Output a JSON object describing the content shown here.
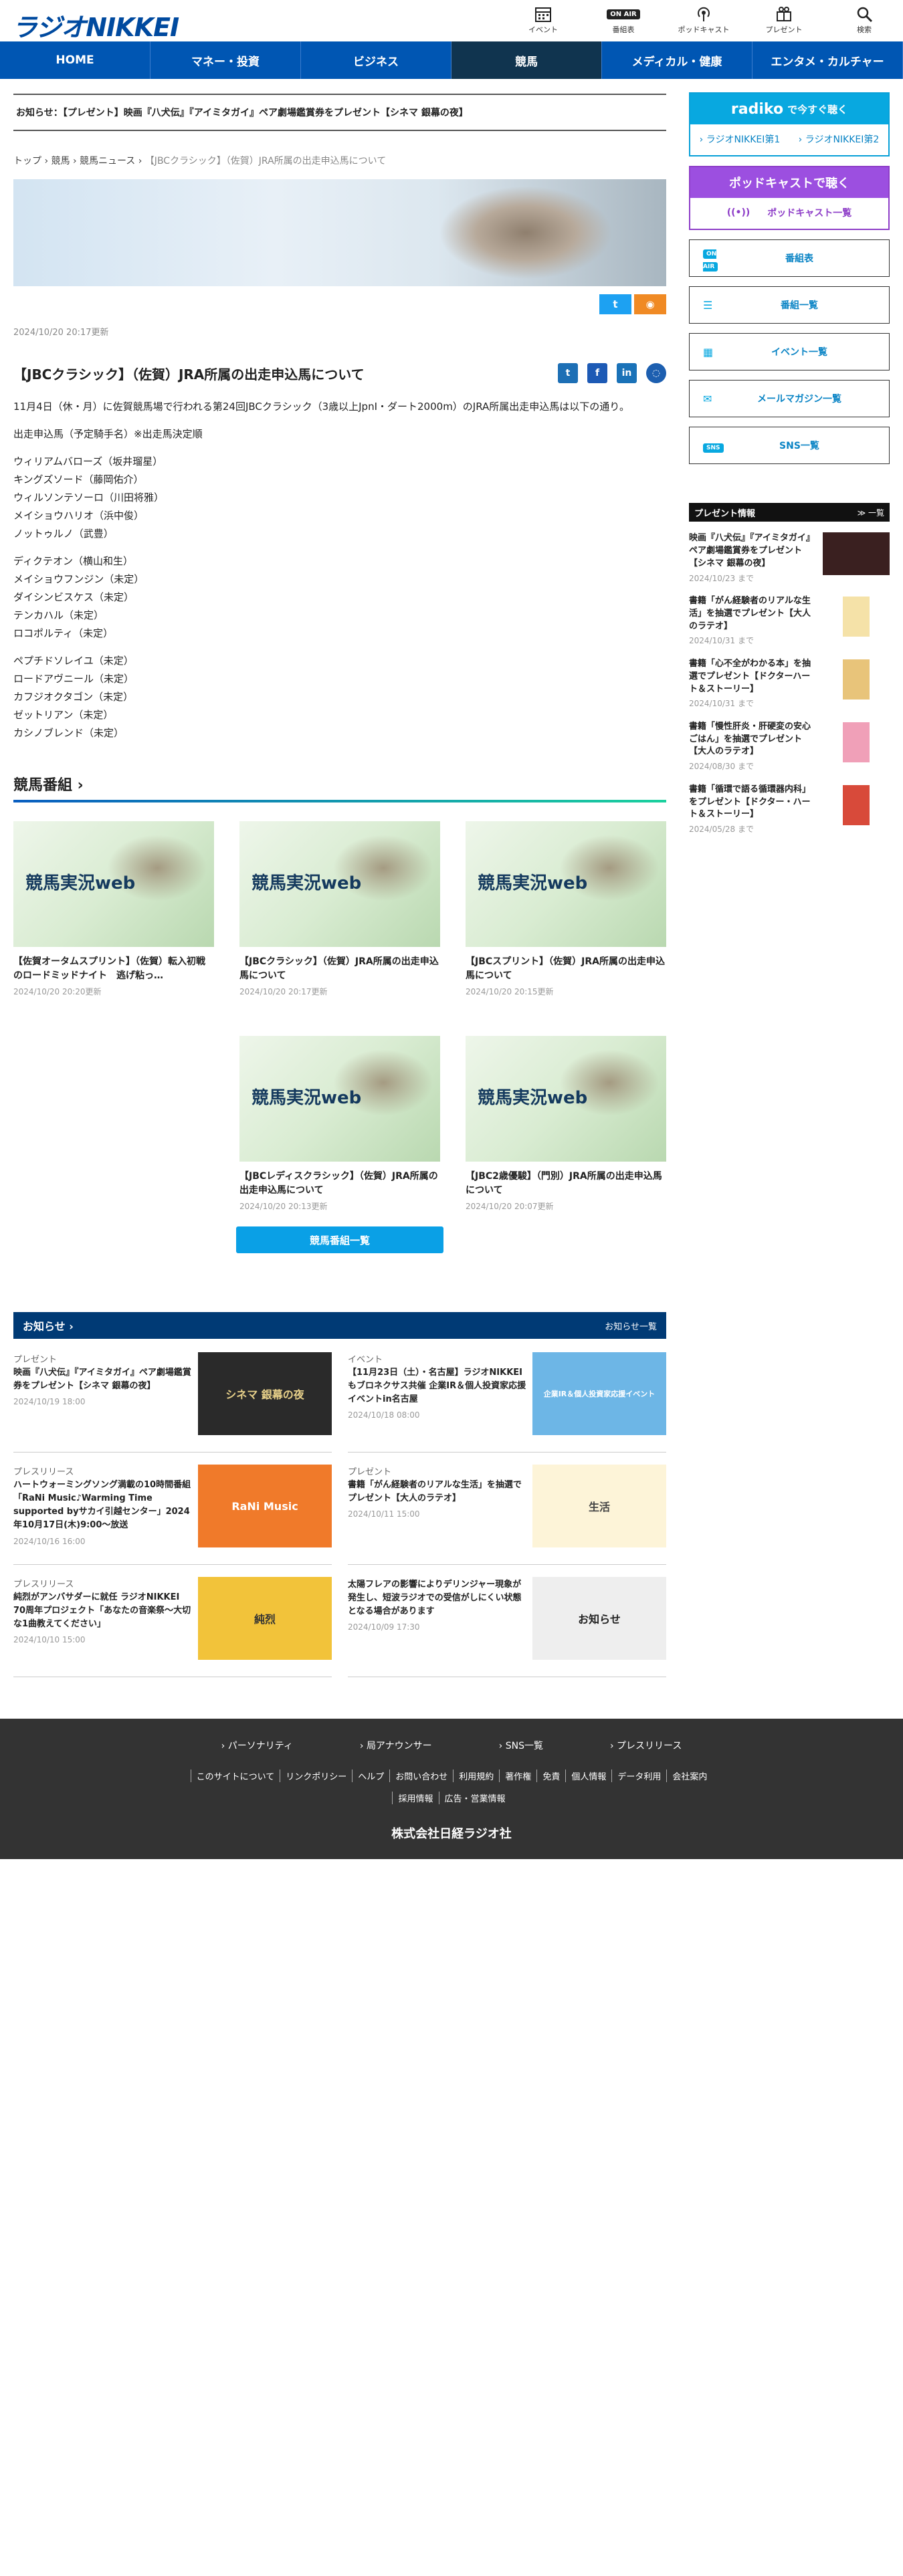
{
  "header": {
    "logo": "ラジオNIKKEI",
    "icons": [
      {
        "name": "calendar-icon",
        "label": "イベント"
      },
      {
        "name": "onair-icon",
        "badge": "ON AIR",
        "label": "番組表"
      },
      {
        "name": "podcast-icon",
        "label": "ポッドキャスト"
      },
      {
        "name": "present-icon",
        "label": "プレゼント"
      },
      {
        "name": "search-icon",
        "label": "検索"
      }
    ]
  },
  "nav": [
    "HOME",
    "マネー・投資",
    "ビジネス",
    "競馬",
    "メディカル・健康",
    "エンタメ・カルチャー"
  ],
  "notice": "お知らせ：【プレゼント】映画『八犬伝』『アイミタガイ』ペア劇場鑑賞券をプレゼント【シネマ 銀幕の夜】",
  "breadcrumb": [
    "トップ",
    "競馬",
    "競馬ニュース",
    "【JBCクラシック】（佐賀）JRA所属の出走申込馬について"
  ],
  "article": {
    "date": "2024/10/20 20:17更新",
    "title": "【JBCクラシック】（佐賀）JRA所属の出走申込馬について",
    "intro": "11月4日（休・月）に佐賀競馬場で行われる第24回JBCクラシック（3歳以上JpnⅠ・ダート2000m）のJRA所属出走申込馬は以下の通り。",
    "sub": "出走申込馬（予定騎手名）※出走馬決定順",
    "groups": [
      [
        "ウィリアムバローズ（坂井瑠星）",
        "キングズソード（藤岡佑介）",
        "ウィルソンテソーロ（川田将雅）",
        "メイショウハリオ（浜中俊）",
        "ノットゥルノ（武豊）"
      ],
      [
        "ディクテオン（横山和生）",
        "メイショウフンジン（未定）",
        "ダイシンビスケス（未定）",
        "テンカハル（未定）",
        "ロコポルティ（未定）"
      ],
      [
        "ペプチドソレイユ（未定）",
        "ロードアヴニール（未定）",
        "カフジオクタゴン（未定）",
        "ゼットリアン（未定）",
        "カシノブレンド（未定）"
      ]
    ]
  },
  "section_title": "競馬番組",
  "cards": [
    {
      "thumb": "競馬実況web",
      "title": "【佐賀オータムスプリント】（佐賀）転入初戦のロードミッドナイト　逃げ粘っ…",
      "date": "2024/10/20 20:20更新"
    },
    {
      "thumb": "競馬実況web",
      "title": "【JBCクラシック】（佐賀）JRA所属の出走申込馬について",
      "date": "2024/10/20 20:17更新"
    },
    {
      "thumb": "競馬実況web",
      "title": "【JBCスプリント】（佐賀）JRA所属の出走申込馬について",
      "date": "2024/10/20 20:15更新"
    },
    {
      "thumb": "競馬実況web",
      "title": "【JBCレディスクラシック】（佐賀）JRA所属の出走申込馬について",
      "date": "2024/10/20 20:13更新"
    },
    {
      "thumb": "競馬実況web",
      "title": "【JBC2歳優駿】（門別）JRA所属の出走申込馬について",
      "date": "2024/10/20 20:07更新"
    }
  ],
  "more_label": "競馬番組一覧",
  "oshirase": {
    "title": "お知らせ",
    "more": "お知らせ一覧"
  },
  "news": [
    {
      "cat": "プレゼント",
      "title": "映画『八犬伝』『アイミタガイ』ペア劇場鑑賞券をプレゼント【シネマ 銀幕の夜】",
      "date": "2024/10/19 18:00",
      "img": "シネマ 銀幕の夜",
      "bg": "#2a2a2a",
      "fg": "#e8d18a"
    },
    {
      "cat": "イベント",
      "title": "【11月23日（土）・名古屋】ラジオNIKKEIもブロネクサス共催 企業IR＆個人投資家応援イベントin名古屋",
      "date": "2024/10/18 08:00",
      "img": "企業IR＆個人投資家応援イベント",
      "bg": "#6db6e6",
      "fg": "#ffffff"
    },
    {
      "cat": "プレスリリース",
      "title": "ハートウォーミングソング満載の10時間番組「RaNi Music♪Warming Time supported byサカイ引越センター」2024年10月17日(木)9:00～放送",
      "date": "2024/10/16 16:00",
      "img": "RaNi Music",
      "bg": "#f07a2a",
      "fg": "#ffffff"
    },
    {
      "cat": "プレゼント",
      "title": "書籍「がん経験者のリアルな生活」を抽選でプレゼント【大人のラテオ】",
      "date": "2024/10/11 15:00",
      "img": "生活",
      "bg": "#fdf4d8",
      "fg": "#444444"
    },
    {
      "cat": "プレスリリース",
      "title": "純烈がアンバサダーに就任 ラジオNIKKEI 70周年プロジェクト「あなたの音楽祭～大切な1曲教えてください」",
      "date": "2024/10/10 15:00",
      "img": "純烈",
      "bg": "#f2c33a",
      "fg": "#333333"
    },
    {
      "cat": "",
      "title": "太陽フレアの影響によりデリンジャー現象が発生し、短波ラジオでの受信がしにくい状態となる場合があります",
      "date": "2024/10/09 17:30",
      "img": "お知らせ",
      "bg": "#eeeeee",
      "fg": "#222222"
    }
  ],
  "sidebar": {
    "radiko_title": "radiko",
    "radiko_sub": "で今すぐ聴く",
    "radiko_links": [
      "ラジオNIKKEI第1",
      "ラジオNIKKEI第2"
    ],
    "podcast_title": "ポッドキャストで聴く",
    "podcast_link": "ポッドキャスト一覧",
    "buttons": [
      {
        "icon": "ON AIR",
        "label": "番組表"
      },
      {
        "icon": "☰",
        "label": "番組一覧"
      },
      {
        "icon": "▦",
        "label": "イベント一覧"
      },
      {
        "icon": "✉",
        "label": "メールマガジン一覧"
      },
      {
        "icon": "SNS",
        "label": "SNS一覧"
      }
    ],
    "present_title": "プレゼント情報",
    "present_more": "≫ 一覧",
    "presents": [
      {
        "title": "映画『八犬伝』『アイミタガイ』ペア劇場鑑賞券をプレゼント【シネマ 銀幕の夜】",
        "date": "2024/10/23 まで",
        "bg": "#3a2020"
      },
      {
        "title": "書籍「がん経験者のリアルな生活」を抽選でプレゼント【大人のラテオ】",
        "date": "2024/10/31 まで",
        "bg": "#f5e2a8"
      },
      {
        "title": "書籍「心不全がわかる本」を抽選でプレゼント【ドクターハート＆ストーリー】",
        "date": "2024/10/31 まで",
        "bg": "#e8c47a"
      },
      {
        "title": "書籍「慢性肝炎・肝硬変の安心ごはん」を抽選でプレゼント【大人のラテオ】",
        "date": "2024/08/30 まで",
        "bg": "#f0a0b8"
      },
      {
        "title": "書籍「循環で語る循環器内科」をプレゼント【ドクター・ハート＆ストーリー】",
        "date": "2024/05/28 まで",
        "bg": "#d84a3a"
      }
    ]
  },
  "footer": {
    "row1": [
      "パーソナリティ",
      "局アナウンサー",
      "SNS一覧",
      "プレスリリース"
    ],
    "row2": [
      "このサイトについて",
      "リンクポリシー",
      "ヘルプ",
      "お問い合わせ",
      "利用規約",
      "著作権",
      "免責",
      "個人情報",
      "データ利用",
      "会社案内",
      "採用情報",
      "広告・営業情報"
    ],
    "company": "株式会社日経ラジオ社"
  },
  "colors": {
    "nav": "#0056b3",
    "nav_active": "#10344f",
    "radiko": "#08a8e0",
    "podcast": "#9c4fe0",
    "more": "#0aa0e6",
    "oshirase": "#003a75",
    "footer": "#333333"
  }
}
